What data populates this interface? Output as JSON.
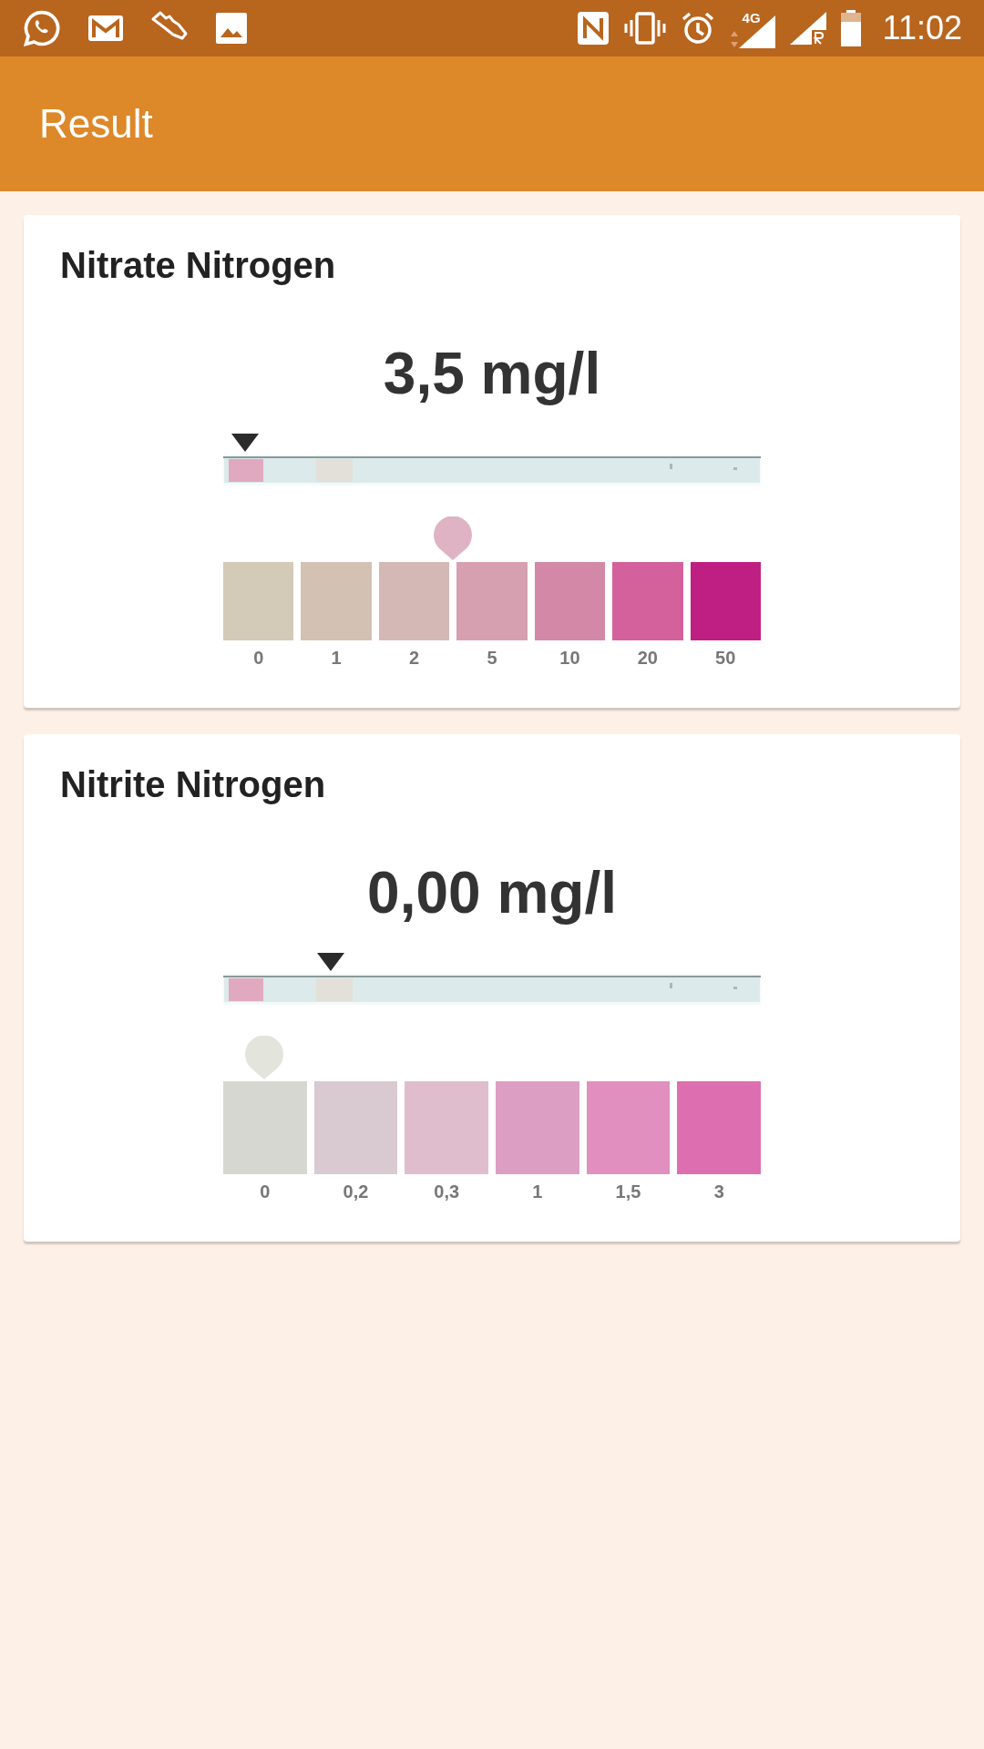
{
  "status_bar": {
    "network": "4G",
    "time": "11:02"
  },
  "app_bar": {
    "title": "Result"
  },
  "results": [
    {
      "title": "Nitrate Nitrogen",
      "value": "3,5 mg/l",
      "marker": {
        "color": "#dfb3c3"
      },
      "scale": [
        {
          "label": "0",
          "color": "#d3cab8"
        },
        {
          "label": "1",
          "color": "#d3c1b4"
        },
        {
          "label": "2",
          "color": "#d4b8b5"
        },
        {
          "label": "5",
          "color": "#d6a0b1"
        },
        {
          "label": "10",
          "color": "#d388a8"
        },
        {
          "label": "20",
          "color": "#d4619c"
        },
        {
          "label": "50",
          "color": "#bf1e82"
        }
      ]
    },
    {
      "title": "Nitrite Nitrogen",
      "value": "0,00 mg/l",
      "marker": {
        "color": "#e3e4dc"
      },
      "scale": [
        {
          "label": "0",
          "color": "#d7d7d2"
        },
        {
          "label": "0,2",
          "color": "#d9c9d0"
        },
        {
          "label": "0,3",
          "color": "#dfbdcd"
        },
        {
          "label": "1",
          "color": "#dd9ec3"
        },
        {
          "label": "1,5",
          "color": "#e18fbe"
        },
        {
          "label": "3",
          "color": "#dd6fb0"
        }
      ]
    }
  ]
}
